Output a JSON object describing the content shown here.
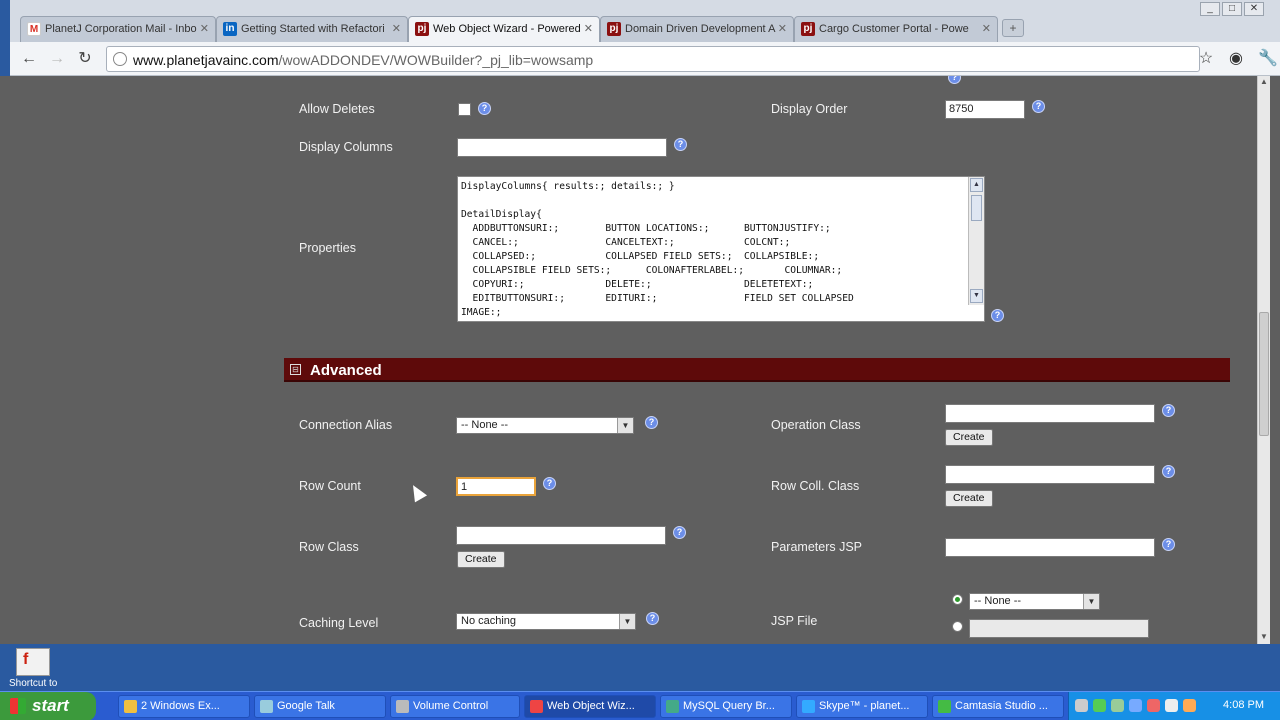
{
  "browser": {
    "tabs": [
      {
        "label": "PlanetJ Corporation Mail - Inbo",
        "icon": "gmail-icon",
        "color": "#d93025",
        "glyph": "M"
      },
      {
        "label": "Getting Started with Refactori",
        "icon": "linkedin-icon",
        "color": "#0a66c2",
        "glyph": "in"
      },
      {
        "label": "Web Object Wizard - Powered",
        "icon": "pj-icon",
        "color": "#8b1010",
        "glyph": "pj"
      },
      {
        "label": "Domain Driven Development A",
        "icon": "pj-icon",
        "color": "#8b1010",
        "glyph": "pj"
      },
      {
        "label": "Cargo Customer Portal - Powe",
        "icon": "pj-icon",
        "color": "#8b1010",
        "glyph": "pj"
      }
    ],
    "url_host": "www.planetjavainc.com",
    "url_path": "/wowADDONDEV/WOWBuilder?_pj_lib=wowsamp"
  },
  "form": {
    "allow_deletes_label": "Allow Deletes",
    "display_order_label": "Display Order",
    "display_order_value": "8750",
    "display_columns_label": "Display Columns",
    "display_columns_value": "",
    "properties_label": "Properties",
    "properties_text": "DisplayColumns{ results:; details:; }\n\nDetailDisplay{\n  ADDBUTTONSURI:;        BUTTON LOCATIONS:;      BUTTONJUSTIFY:;\n  CANCEL:;               CANCELTEXT:;            COLCNT:;\n  COLLAPSED:;            COLLAPSED FIELD SETS:;  COLLAPSIBLE:;\n  COLLAPSIBLE FIELD SETS:;      COLONAFTERLABEL:;       COLUMNAR:;\n  COPYURI:;              DELETE:;                DELETETEXT:;\n  EDITBUTTONSURI:;       EDITURI:;               FIELD SET COLLAPSED\nIMAGE:;"
  },
  "advanced": {
    "title": "Advanced",
    "connection_alias_label": "Connection Alias",
    "connection_alias_value": "-- None --",
    "operation_class_label": "Operation Class",
    "row_count_label": "Row Count",
    "row_count_value": "1",
    "row_coll_class_label": "Row Coll. Class",
    "row_class_label": "Row Class",
    "parameters_jsp_label": "Parameters JSP",
    "caching_level_label": "Caching Level",
    "caching_level_value": "No caching",
    "jsp_file_label": "JSP File",
    "jsp_file_select_value": "-- None --",
    "create_label": "Create"
  },
  "desktop": {
    "shortcut_label": "Shortcut to"
  },
  "taskbar": {
    "start_label": "start",
    "items": [
      {
        "label": "2 Windows Ex...",
        "icon": "folder-icon"
      },
      {
        "label": "Google Talk",
        "icon": "gtalk-icon"
      },
      {
        "label": "Volume Control",
        "icon": "volume-icon"
      },
      {
        "label": "Web Object Wiz...",
        "icon": "chrome-icon"
      },
      {
        "label": "MySQL Query Br...",
        "icon": "mysql-icon"
      },
      {
        "label": "Skype™ - planet...",
        "icon": "skype-icon"
      },
      {
        "label": "Camtasia Studio ...",
        "icon": "camtasia-icon"
      }
    ],
    "clock": "4:08 PM"
  }
}
